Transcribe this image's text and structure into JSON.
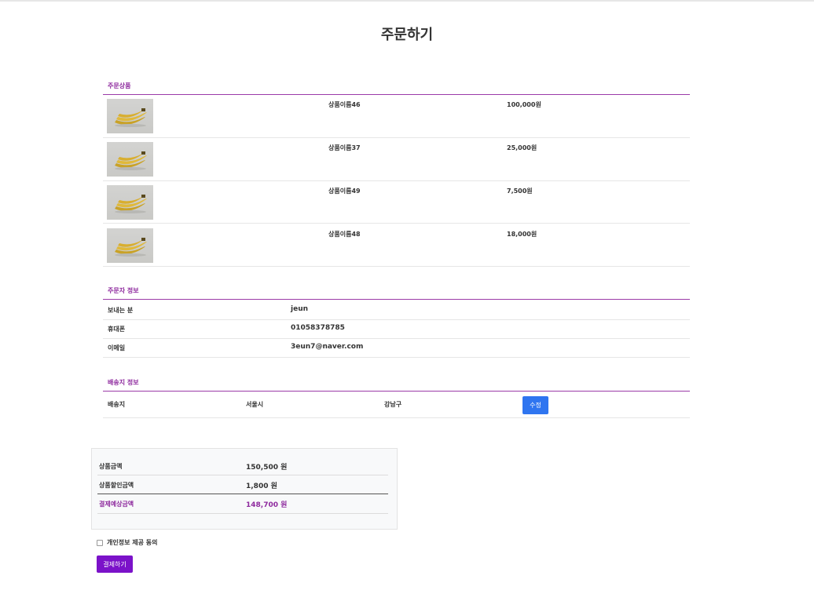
{
  "page": {
    "title": "주문하기"
  },
  "products": {
    "section_title": "주문상품",
    "items": [
      {
        "name": "상품이름46",
        "price": "100,000원"
      },
      {
        "name": "상품이름37",
        "price": "25,000원"
      },
      {
        "name": "상품이름49",
        "price": "7,500원"
      },
      {
        "name": "상품이름48",
        "price": "18,000원"
      }
    ]
  },
  "orderer": {
    "section_title": "주문자 정보",
    "rows": [
      {
        "label": "보내는 분",
        "value": "jeun"
      },
      {
        "label": "휴대폰",
        "value": "01058378785"
      },
      {
        "label": "이메일",
        "value": "3eun7@naver.com"
      }
    ]
  },
  "shipping": {
    "section_title": "배송지 정보",
    "label": "배송지",
    "city": "서울시",
    "district": "강남구",
    "edit_label": "수정"
  },
  "summary": {
    "rows": [
      {
        "label": "상품금액",
        "value": "150,500 원"
      },
      {
        "label": "상품할인금액",
        "value": "1,800 원"
      },
      {
        "label": "결제예상금액",
        "value": "148,700 원"
      }
    ]
  },
  "agreement": {
    "label": "개인정보 제공 동의",
    "checked": false
  },
  "pay": {
    "label": "결제하기"
  },
  "colors": {
    "accent": "#8e2a9e",
    "edit_button": "#2f75f0",
    "pay_button": "#7b12c9"
  }
}
